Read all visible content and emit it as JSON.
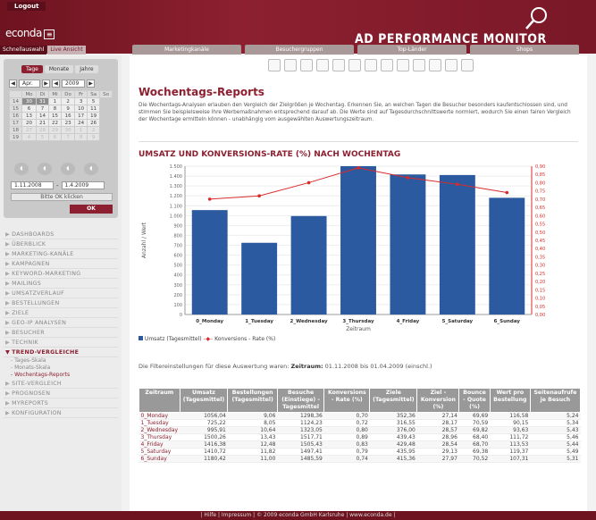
{
  "header": {
    "logout": "Logout",
    "logo": "econda",
    "logo_box": "≡",
    "app_title": "AD PERFORMANCE MONITOR",
    "subtabs": [
      "Schnellauswahl",
      "Live Ansicht"
    ],
    "topnav": [
      "Marketingkanäle",
      "Besuchergruppen",
      "Top-Länder",
      "Shops"
    ]
  },
  "calendar": {
    "tabs": [
      "Tage",
      "Monate",
      "Jahre"
    ],
    "month": "Apr.",
    "year": "2009",
    "weekdays": [
      "Mo",
      "Di",
      "Mi",
      "Do",
      "Fr",
      "Sa",
      "So"
    ],
    "weeks": [
      [
        "14",
        "30",
        "31",
        "1",
        "2",
        "3",
        "5"
      ],
      [
        "15",
        "6",
        "7",
        "8",
        "9",
        "10",
        "11"
      ],
      [
        "16",
        "13",
        "14",
        "15",
        "16",
        "17",
        "19"
      ],
      [
        "17",
        "20",
        "21",
        "22",
        "23",
        "24",
        "26"
      ],
      [
        "18",
        "27",
        "28",
        "29",
        "30",
        "1",
        "2"
      ],
      [
        "19",
        "4",
        "5",
        "6",
        "7",
        "8",
        "9"
      ]
    ],
    "date_from": "1.11.2008",
    "date_to": "1.4.2009",
    "hint": "Bitte OK klicken",
    "ok": "OK"
  },
  "menu": {
    "items": [
      "DASHBOARDS",
      "ÜBERBLICK",
      "MARKETING-KANÄLE",
      "KAMPAGNEN",
      "KEYWORD-MARKETING",
      "MAILINGS",
      "UMSATZVERLAUF",
      "BESTELLUNGEN",
      "ZIELE",
      "GEO-IP ANALYSEN",
      "BESUCHER",
      "TECHNIK"
    ],
    "active": "TREND-VERGLEICHE",
    "sub": [
      "Tages-Skala",
      "Monats-Skala",
      "Wochentags-Reports"
    ],
    "after": [
      "SITE-VERGLEICH",
      "PROGNOSEN",
      "MYREPORTS",
      "KONFIGURATION"
    ]
  },
  "page": {
    "title": "Wochentags-Reports",
    "intro": "Die Wochentags-Analysen erlauben den Vergleich der Zielgrößen je Wochentag. Erkennen Sie, an welchen Tagen die Besucher besonders kaufentschlossen sind, und stimmen Sie beispielsweise Ihre Werbemaßnahmen entsprechend darauf ab. Die Werte sind auf Tagesdurchschnittswerte normiert, wodurch Sie einen fairen Vergleich der Wochentage ermitteln können - unabhängig vom ausgewählten Auswertungszeitraum.",
    "chart_title": "UMSATZ UND KONVERSIONS-RATE (%) NACH WOCHENTAG",
    "filter_prefix": "Die Filtereinstellungen für diese Auswertung waren:",
    "filter_label": "Zeitraum:",
    "filter_value": "01.11.2008 bis 01.04.2009 (einschl.)",
    "legend_bar": "Umsatz (Tagesmittel)",
    "legend_line": "Konversions - Rate (%)"
  },
  "chart_data": {
    "type": "bar",
    "categories": [
      "0_Monday",
      "1_Tuesday",
      "2_Wednesday",
      "3_Thursday",
      "4_Friday",
      "5_Saturday",
      "6_Sunday"
    ],
    "series": [
      {
        "name": "Umsatz (Tagesmittel)",
        "values": [
          1056.04,
          725.22,
          995.91,
          1500.26,
          1416.38,
          1410.72,
          1180.42
        ]
      },
      {
        "name": "Konversions - Rate (%)",
        "values": [
          0.7,
          0.72,
          0.8,
          0.89,
          0.83,
          0.79,
          0.74
        ],
        "axis": "right"
      }
    ],
    "xlabel": "Zeitraum",
    "ylabel": "Anzahl / Wert",
    "ylim": [
      0,
      1500
    ],
    "y2lim": [
      0,
      0.9
    ],
    "yticks": [
      "0",
      "100",
      "200",
      "300",
      "400",
      "500",
      "600",
      "700",
      "800",
      "900",
      "1.000",
      "1.100",
      "1.200",
      "1.300",
      "1.400",
      "1.500"
    ],
    "y2ticks": [
      "0,00",
      "0,05",
      "0,10",
      "0,15",
      "0,20",
      "0,25",
      "0,30",
      "0,35",
      "0,40",
      "0,45",
      "0,50",
      "0,55",
      "0,60",
      "0,65",
      "0,70",
      "0,75",
      "0,80",
      "0,85",
      "0,90"
    ],
    "colors": {
      "bar": "#2c5aa0",
      "line": "#d92b2b"
    }
  },
  "table": {
    "headers": [
      "Zeitraum",
      "Umsatz (Tagesmittel)",
      "Bestellungen (Tagesmittel)",
      "Besuche (Einstiege) - Tagesmittel",
      "Konversions - Rate (%)",
      "Ziele (Tagesmittel)",
      "Ziel - Konversion (%)",
      "Bounce - Quote (%)",
      "Wert pro Bestellung",
      "Seitenaufrufe je Besuch"
    ],
    "rows": [
      [
        "0_Monday",
        "1056,04",
        "9,06",
        "1298,36",
        "0,70",
        "352,36",
        "27,14",
        "69,69",
        "116,58",
        "5,24"
      ],
      [
        "1_Tuesday",
        "725,22",
        "8,05",
        "1124,23",
        "0,72",
        "316,55",
        "28,17",
        "70,59",
        "90,15",
        "5,34"
      ],
      [
        "2_Wednesday",
        "995,91",
        "10,64",
        "1323,05",
        "0,80",
        "376,00",
        "28,57",
        "69,82",
        "93,63",
        "5,43"
      ],
      [
        "3_Thursday",
        "1500,26",
        "13,43",
        "1517,71",
        "0,89",
        "439,43",
        "28,96",
        "68,40",
        "111,72",
        "5,46"
      ],
      [
        "4_Friday",
        "1416,38",
        "12,48",
        "1505,43",
        "0,83",
        "429,48",
        "28,54",
        "68,70",
        "113,53",
        "5,44"
      ],
      [
        "5_Saturday",
        "1410,72",
        "11,82",
        "1497,41",
        "0,79",
        "435,95",
        "29,13",
        "69,38",
        "119,37",
        "5,49"
      ],
      [
        "6_Sunday",
        "1180,42",
        "11,00",
        "1485,59",
        "0,74",
        "415,36",
        "27,97",
        "70,52",
        "107,31",
        "5,31"
      ]
    ]
  },
  "footer": "| Hilfe | Impressum | © 2009 econda GmbH Karlsruhe | www.econda.de |"
}
